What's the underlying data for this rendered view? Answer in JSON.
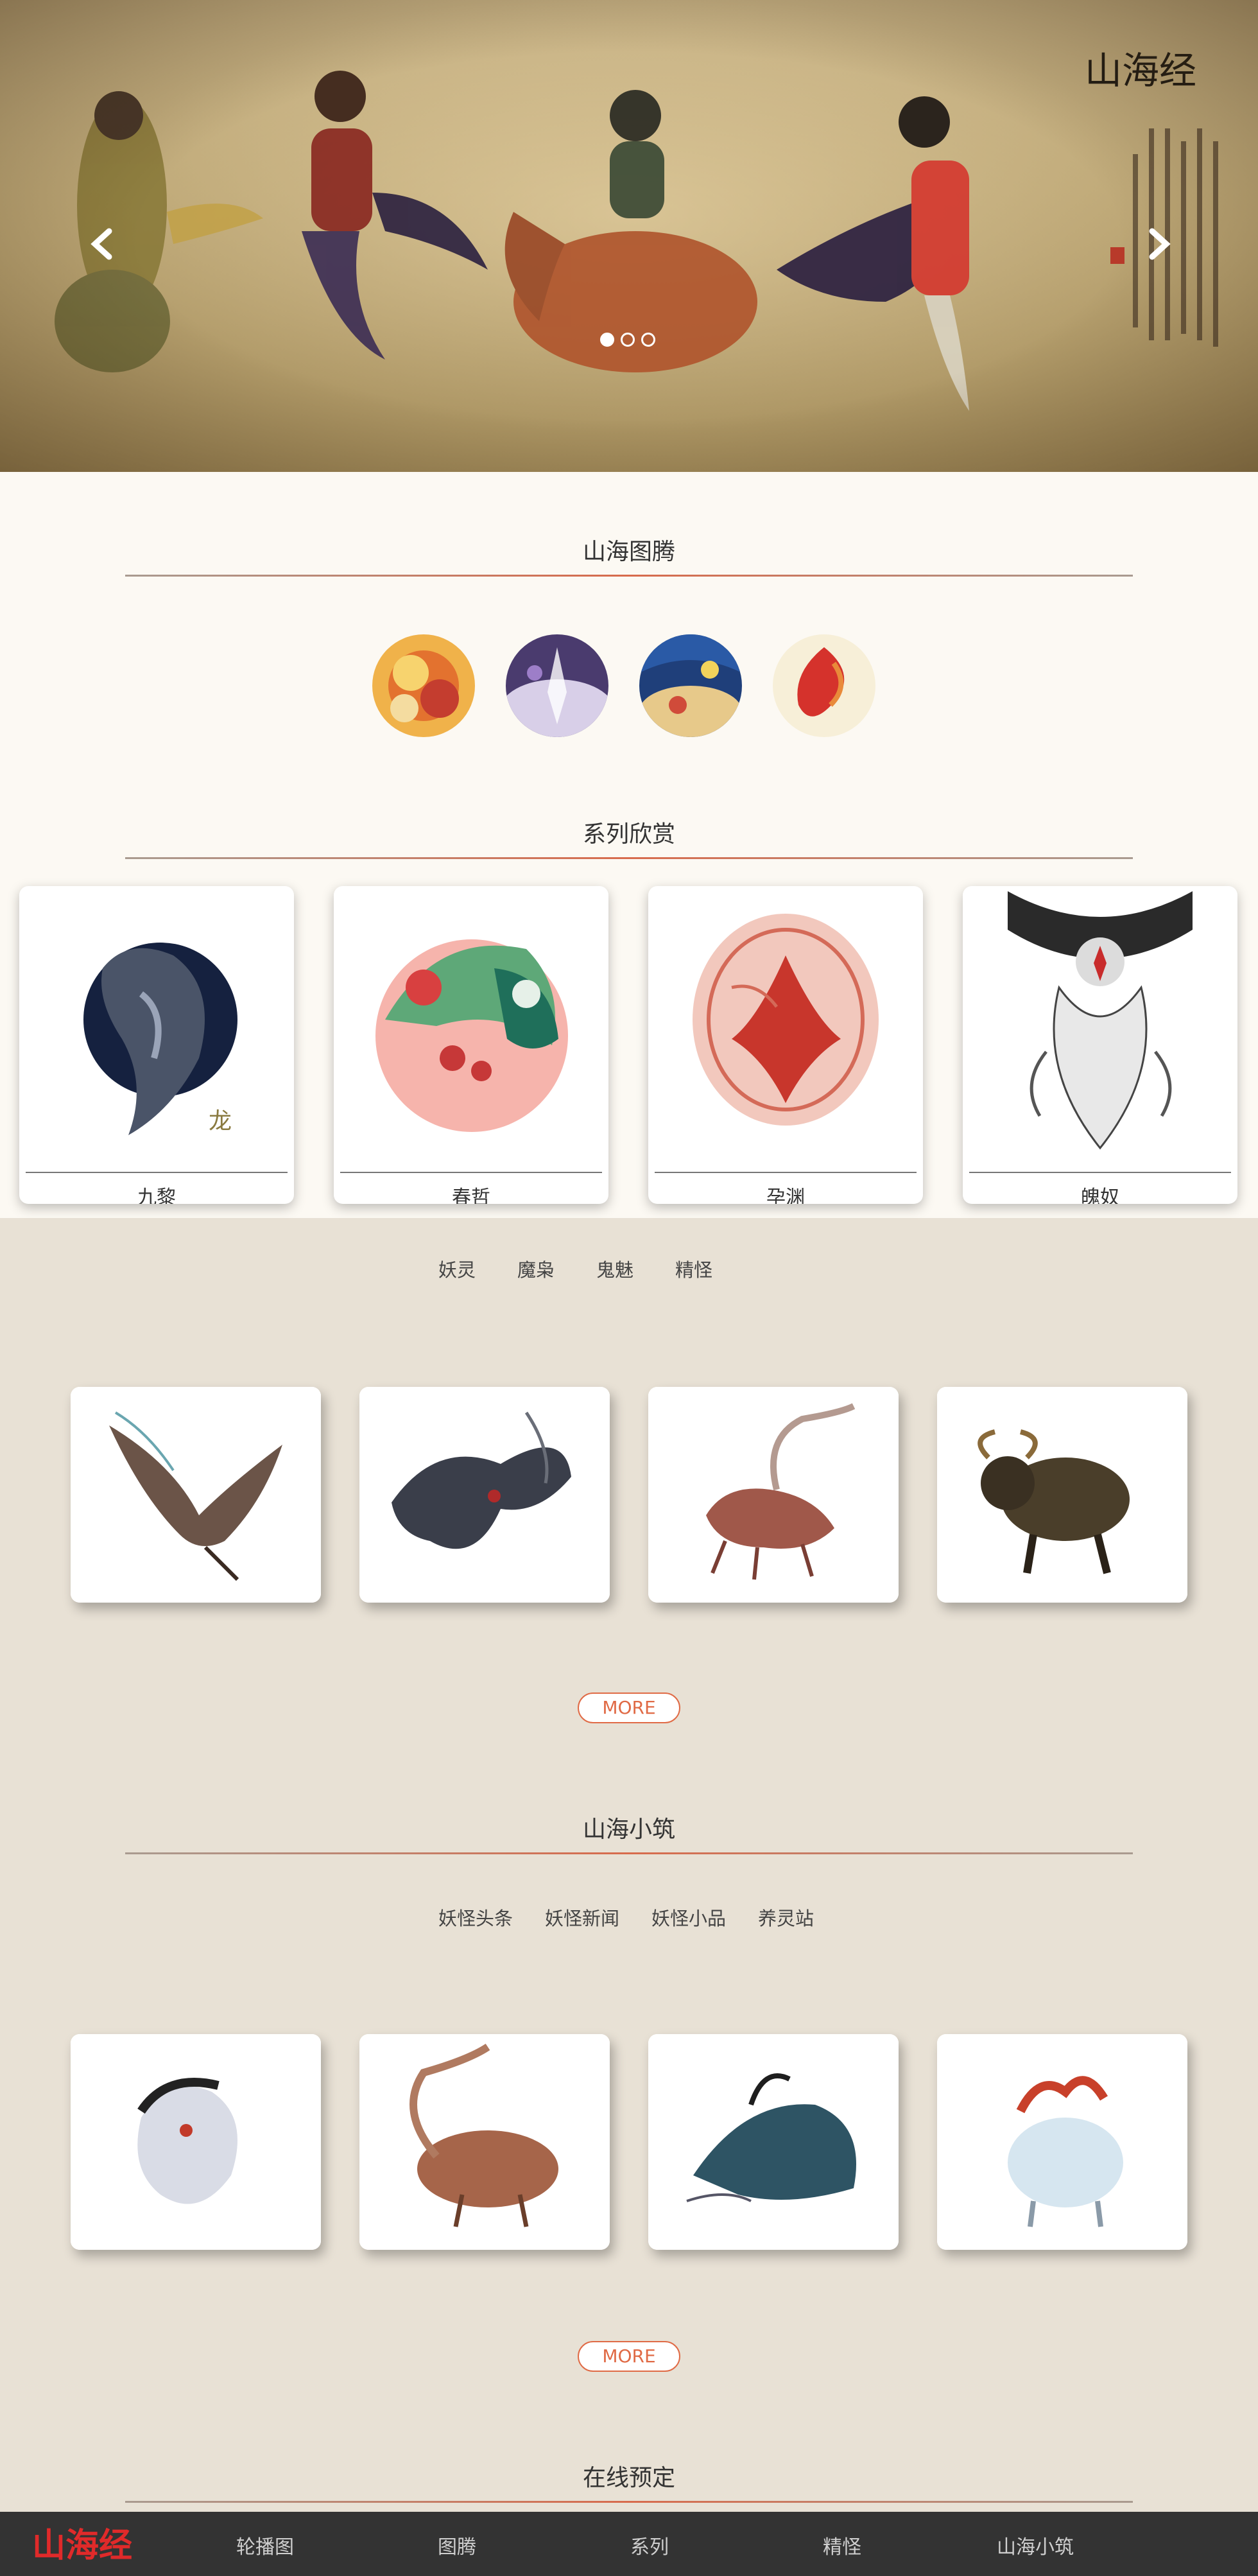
{
  "hero": {
    "calligraphy": "山海经",
    "dots": [
      true,
      false,
      false
    ]
  },
  "sections": {
    "totem": {
      "title": "山海图腾"
    },
    "series": {
      "title": "系列欣赏",
      "cards": [
        "九黎",
        "春哲",
        "孕渊",
        "魄奴"
      ]
    },
    "monsters": {
      "tabs": [
        "妖灵",
        "魔枭",
        "鬼魅",
        "精怪"
      ],
      "more": "MORE"
    },
    "cottage": {
      "title": "山海小筑",
      "tabs": [
        "妖怪头条",
        "妖怪新闻",
        "妖怪小品",
        "养灵站"
      ],
      "more": "MORE"
    },
    "booking": {
      "title": "在线预定"
    }
  },
  "nav": {
    "logo": "山海经",
    "items": [
      "轮播图",
      "图腾",
      "系列",
      "精怪",
      "山海小筑"
    ]
  },
  "colors": {
    "accent": "#e06a45",
    "nav_bg": "#333333",
    "upper_bg": "#fcf9f3",
    "lower_bg": "#e8e1d5"
  }
}
